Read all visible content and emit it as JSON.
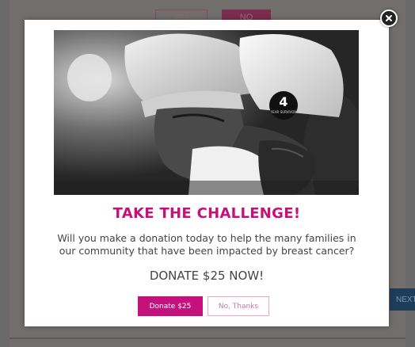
{
  "background_page": {
    "yes_label": "YES",
    "no_label": "NO",
    "next_label": "NEXT"
  },
  "modal": {
    "title": "TAKE THE CHALLENGE!",
    "description": "Will you make a donation today to help the many families in our community that have been impacted by breast cancer?",
    "cta": "DONATE $25 NOW!",
    "donate_button": "Donate $25",
    "decline_button": "No, Thanks",
    "photo_badge_number": "4",
    "photo_badge_text": "YEAR SURVIVOR"
  },
  "icons": {
    "close": "close-icon"
  },
  "colors": {
    "accent": "#c4117b",
    "overlay": "#6b6a6a"
  }
}
